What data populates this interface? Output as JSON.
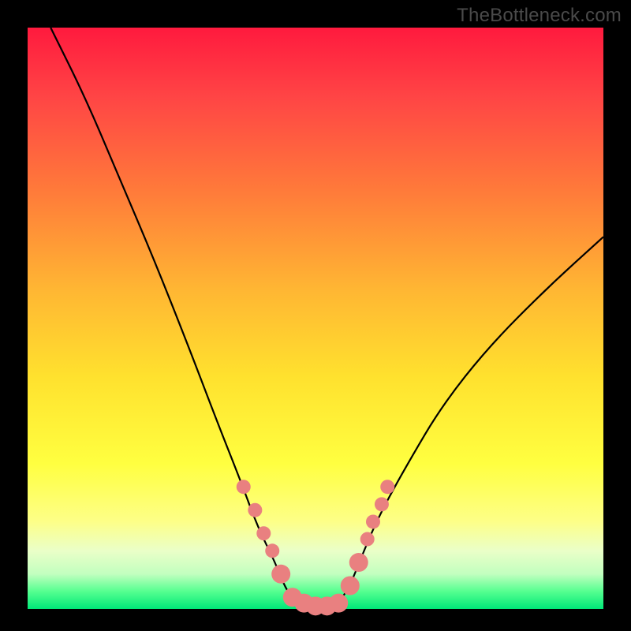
{
  "watermark": "TheBottleneck.com",
  "chart_data": {
    "type": "line",
    "title": "",
    "xlabel": "",
    "ylabel": "",
    "xlim": [
      0,
      100
    ],
    "ylim": [
      0,
      100
    ],
    "series": [
      {
        "name": "bottleneck-curve",
        "x": [
          4,
          10,
          16,
          22,
          28,
          33,
          37,
          40,
          43,
          45,
          47,
          49,
          51,
          54,
          56,
          58,
          61,
          66,
          72,
          80,
          90,
          100
        ],
        "values": [
          100,
          88,
          74,
          60,
          45,
          32,
          22,
          14,
          8,
          3,
          1,
          0,
          0,
          1,
          4,
          9,
          16,
          25,
          35,
          45,
          55,
          64
        ]
      }
    ],
    "markers": {
      "name": "highlight-points",
      "x": [
        37.5,
        39.5,
        41,
        42.5,
        44,
        46,
        48,
        50,
        52,
        54,
        56,
        57.5,
        59,
        60,
        61.5,
        62.5
      ],
      "values": [
        21,
        17,
        13,
        10,
        6,
        2,
        1,
        0.5,
        0.5,
        1,
        4,
        8,
        12,
        15,
        18,
        21
      ],
      "color": "#e98080",
      "size_small": 9,
      "size_large": 12
    },
    "gradient_stops": [
      {
        "pos": 0,
        "color": "#ff1a3e"
      },
      {
        "pos": 12,
        "color": "#ff4545"
      },
      {
        "pos": 28,
        "color": "#ff7a3a"
      },
      {
        "pos": 45,
        "color": "#ffb633"
      },
      {
        "pos": 60,
        "color": "#ffe12e"
      },
      {
        "pos": 75,
        "color": "#ffff40"
      },
      {
        "pos": 85,
        "color": "#fdff88"
      },
      {
        "pos": 90,
        "color": "#eaffc8"
      },
      {
        "pos": 94,
        "color": "#c2ffbf"
      },
      {
        "pos": 97,
        "color": "#55ff90"
      },
      {
        "pos": 100,
        "color": "#00e878"
      }
    ]
  }
}
